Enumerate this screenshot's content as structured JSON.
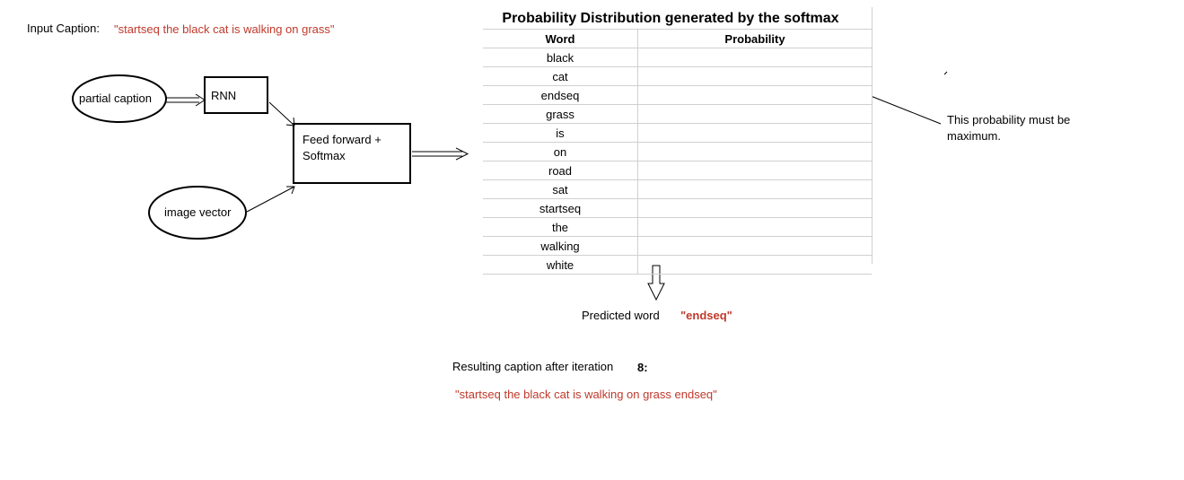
{
  "input_caption": {
    "label": "Input Caption:",
    "value": "\"startseq the black cat is walking on grass\""
  },
  "diagram": {
    "partial_caption": "partial caption",
    "rnn": "RNN",
    "feed_forward": "Feed forward +",
    "softmax": "Softmax",
    "image_vector": "image vector"
  },
  "table": {
    "title": "Probability Distribution generated by the softmax",
    "headers": [
      "Word",
      "Probability"
    ],
    "rows": [
      {
        "word": "black",
        "probability": ""
      },
      {
        "word": "cat",
        "probability": ""
      },
      {
        "word": "endseq",
        "probability": ""
      },
      {
        "word": "grass",
        "probability": ""
      },
      {
        "word": "is",
        "probability": ""
      },
      {
        "word": "on",
        "probability": ""
      },
      {
        "word": "road",
        "probability": ""
      },
      {
        "word": "sat",
        "probability": ""
      },
      {
        "word": "startseq",
        "probability": ""
      },
      {
        "word": "the",
        "probability": ""
      },
      {
        "word": "walking",
        "probability": ""
      },
      {
        "word": "white",
        "probability": ""
      }
    ]
  },
  "annotation": {
    "line1": "This probability must be",
    "line2": "maximum."
  },
  "prediction": {
    "label": "Predicted word",
    "value": "\"endseq\""
  },
  "result": {
    "label": "Resulting caption after iteration",
    "iteration": "8:",
    "caption": "\"startseq the black cat is walking on grass endseq\""
  },
  "colors": {
    "highlight": "#c0392b",
    "line": "#000000",
    "grid": "#d0d0d0"
  }
}
